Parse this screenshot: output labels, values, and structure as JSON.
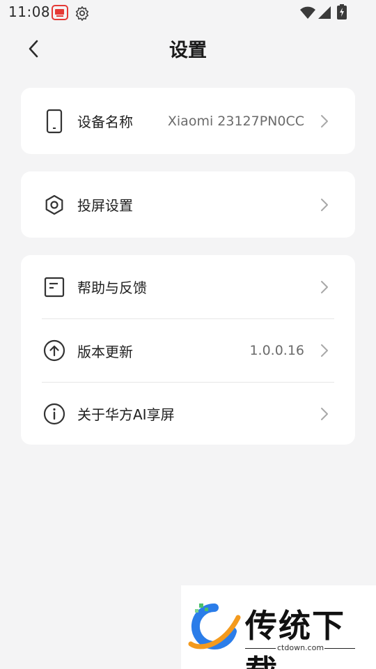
{
  "status_bar": {
    "time": "11:08",
    "icons": [
      "app-notification-icon",
      "gear-icon",
      "wifi-icon",
      "cell-signal-icon",
      "battery-charging-icon"
    ]
  },
  "header": {
    "title": "设置",
    "back_icon": "chevron-left-icon"
  },
  "cards": [
    {
      "rows": [
        {
          "icon": "phone-icon",
          "label": "设备名称",
          "value": "Xiaomi 23127PN0CC"
        }
      ]
    },
    {
      "rows": [
        {
          "icon": "hexagon-settings-icon",
          "label": "投屏设置",
          "value": ""
        }
      ]
    },
    {
      "rows": [
        {
          "icon": "document-icon",
          "label": "帮助与反馈",
          "value": ""
        },
        {
          "icon": "upload-arrow-icon",
          "label": "版本更新",
          "value": "1.0.0.16"
        },
        {
          "icon": "info-icon",
          "label": "关于华方AI享屏",
          "value": ""
        }
      ]
    }
  ],
  "watermark": {
    "brand": "传统下载",
    "url": "ctdown.com",
    "colors": {
      "blue": "#2b7de9",
      "orange": "#f39a1e",
      "green": "#4bbf6b"
    }
  }
}
